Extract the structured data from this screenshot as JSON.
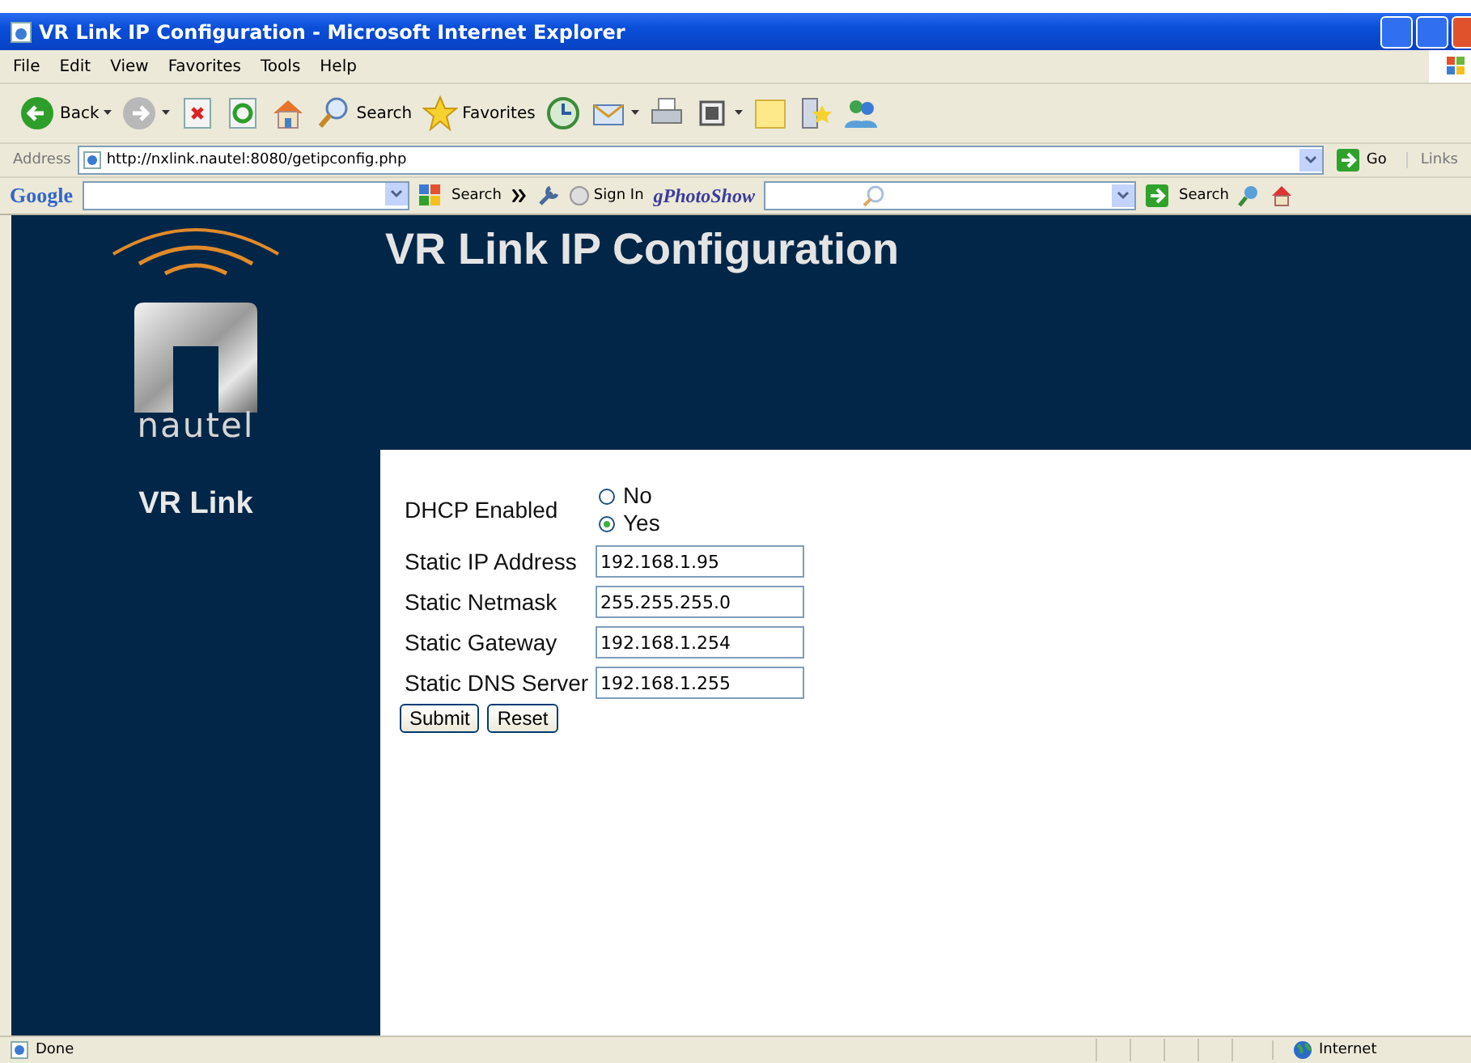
{
  "window": {
    "title": "VR Link IP Configuration - Microsoft Internet Explorer"
  },
  "menu": [
    "File",
    "Edit",
    "View",
    "Favorites",
    "Tools",
    "Help"
  ],
  "toolbar": {
    "back": "Back",
    "search": "Search",
    "favorites": "Favorites"
  },
  "address_bar": {
    "label": "Address",
    "url": "http://nxlink.nautel:8080/getipconfig.php",
    "go": "Go",
    "links": "Links"
  },
  "google_bar": {
    "logo": "Google",
    "search": "Search",
    "sign_in": "Sign In",
    "photo_show": "gPhotoShow",
    "search_2": "Search"
  },
  "sidebar": {
    "brand": "nautel",
    "product": "VR Link"
  },
  "page": {
    "heading": "VR Link IP Configuration",
    "dhcp": {
      "label": "DHCP Enabled",
      "options": [
        {
          "label": "No",
          "selected": false
        },
        {
          "label": "Yes",
          "selected": true
        }
      ]
    },
    "fields": [
      {
        "label": "Static IP Address",
        "value": "192.168.1.95"
      },
      {
        "label": "Static Netmask",
        "value": "255.255.255.0"
      },
      {
        "label": "Static Gateway",
        "value": "192.168.1.254"
      },
      {
        "label": "Static DNS Server",
        "value": "192.168.1.255"
      }
    ],
    "buttons": [
      "Submit",
      "Reset"
    ]
  },
  "status_bar": {
    "text": "Done",
    "zone": "Internet"
  }
}
